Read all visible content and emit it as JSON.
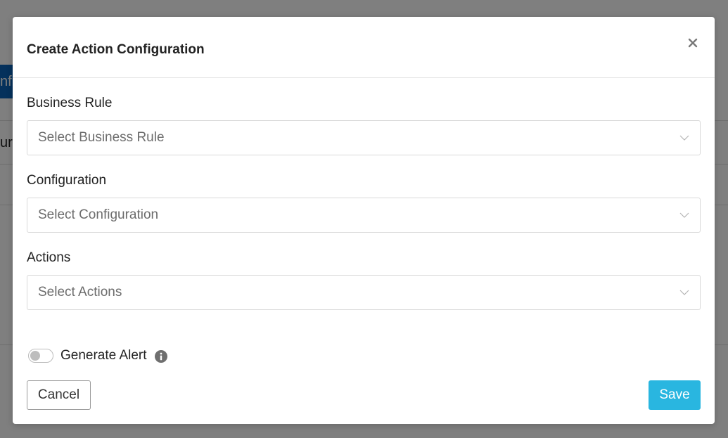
{
  "background": {
    "button_fragment": "nfi",
    "text_fragment": "ur"
  },
  "modal": {
    "title": "Create Action Configuration",
    "close_icon": "close-icon",
    "fields": [
      {
        "label": "Business Rule",
        "placeholder": "Select Business Rule"
      },
      {
        "label": "Configuration",
        "placeholder": "Select Configuration"
      },
      {
        "label": "Actions",
        "placeholder": "Select Actions"
      }
    ],
    "generate_alert": {
      "label": "Generate Alert",
      "enabled": false,
      "info_icon": "info-icon"
    },
    "cancel_label": "Cancel",
    "save_label": "Save"
  },
  "colors": {
    "primary": "#29b6e0",
    "background_button": "#0b63b8",
    "overlay": "rgba(0,0,0,0.5)"
  }
}
